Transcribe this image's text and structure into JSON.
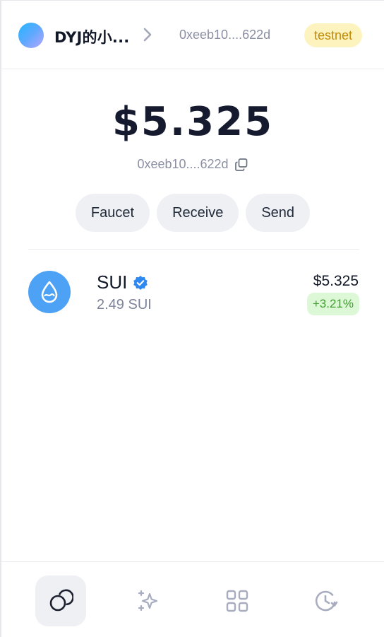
{
  "header": {
    "wallet_name": "DYJ的小...",
    "address_short": "0xeeb10....622d",
    "network_badge": "testnet"
  },
  "balance": {
    "total": "$5.325",
    "address_short": "0xeeb10....622d"
  },
  "actions": {
    "faucet_label": "Faucet",
    "receive_label": "Receive",
    "send_label": "Send"
  },
  "assets": [
    {
      "symbol": "SUI",
      "amount": "2.49 SUI",
      "value": "$5.325",
      "change": "+3.21%",
      "icon": "sui-drop-icon",
      "verified": true
    }
  ],
  "bottom_nav": [
    {
      "icon": "coins-icon",
      "active": true
    },
    {
      "icon": "sparkles-icon",
      "active": false
    },
    {
      "icon": "apps-grid-icon",
      "active": false
    },
    {
      "icon": "history-icon",
      "active": false
    }
  ],
  "colors": {
    "accent": "#4da2f5",
    "badge_bg": "#fdf3bf",
    "badge_text": "#c28a06",
    "positive_bg": "#dcf8d6",
    "positive_text": "#3f9e2f",
    "muted_text": "#8a8fa3"
  }
}
